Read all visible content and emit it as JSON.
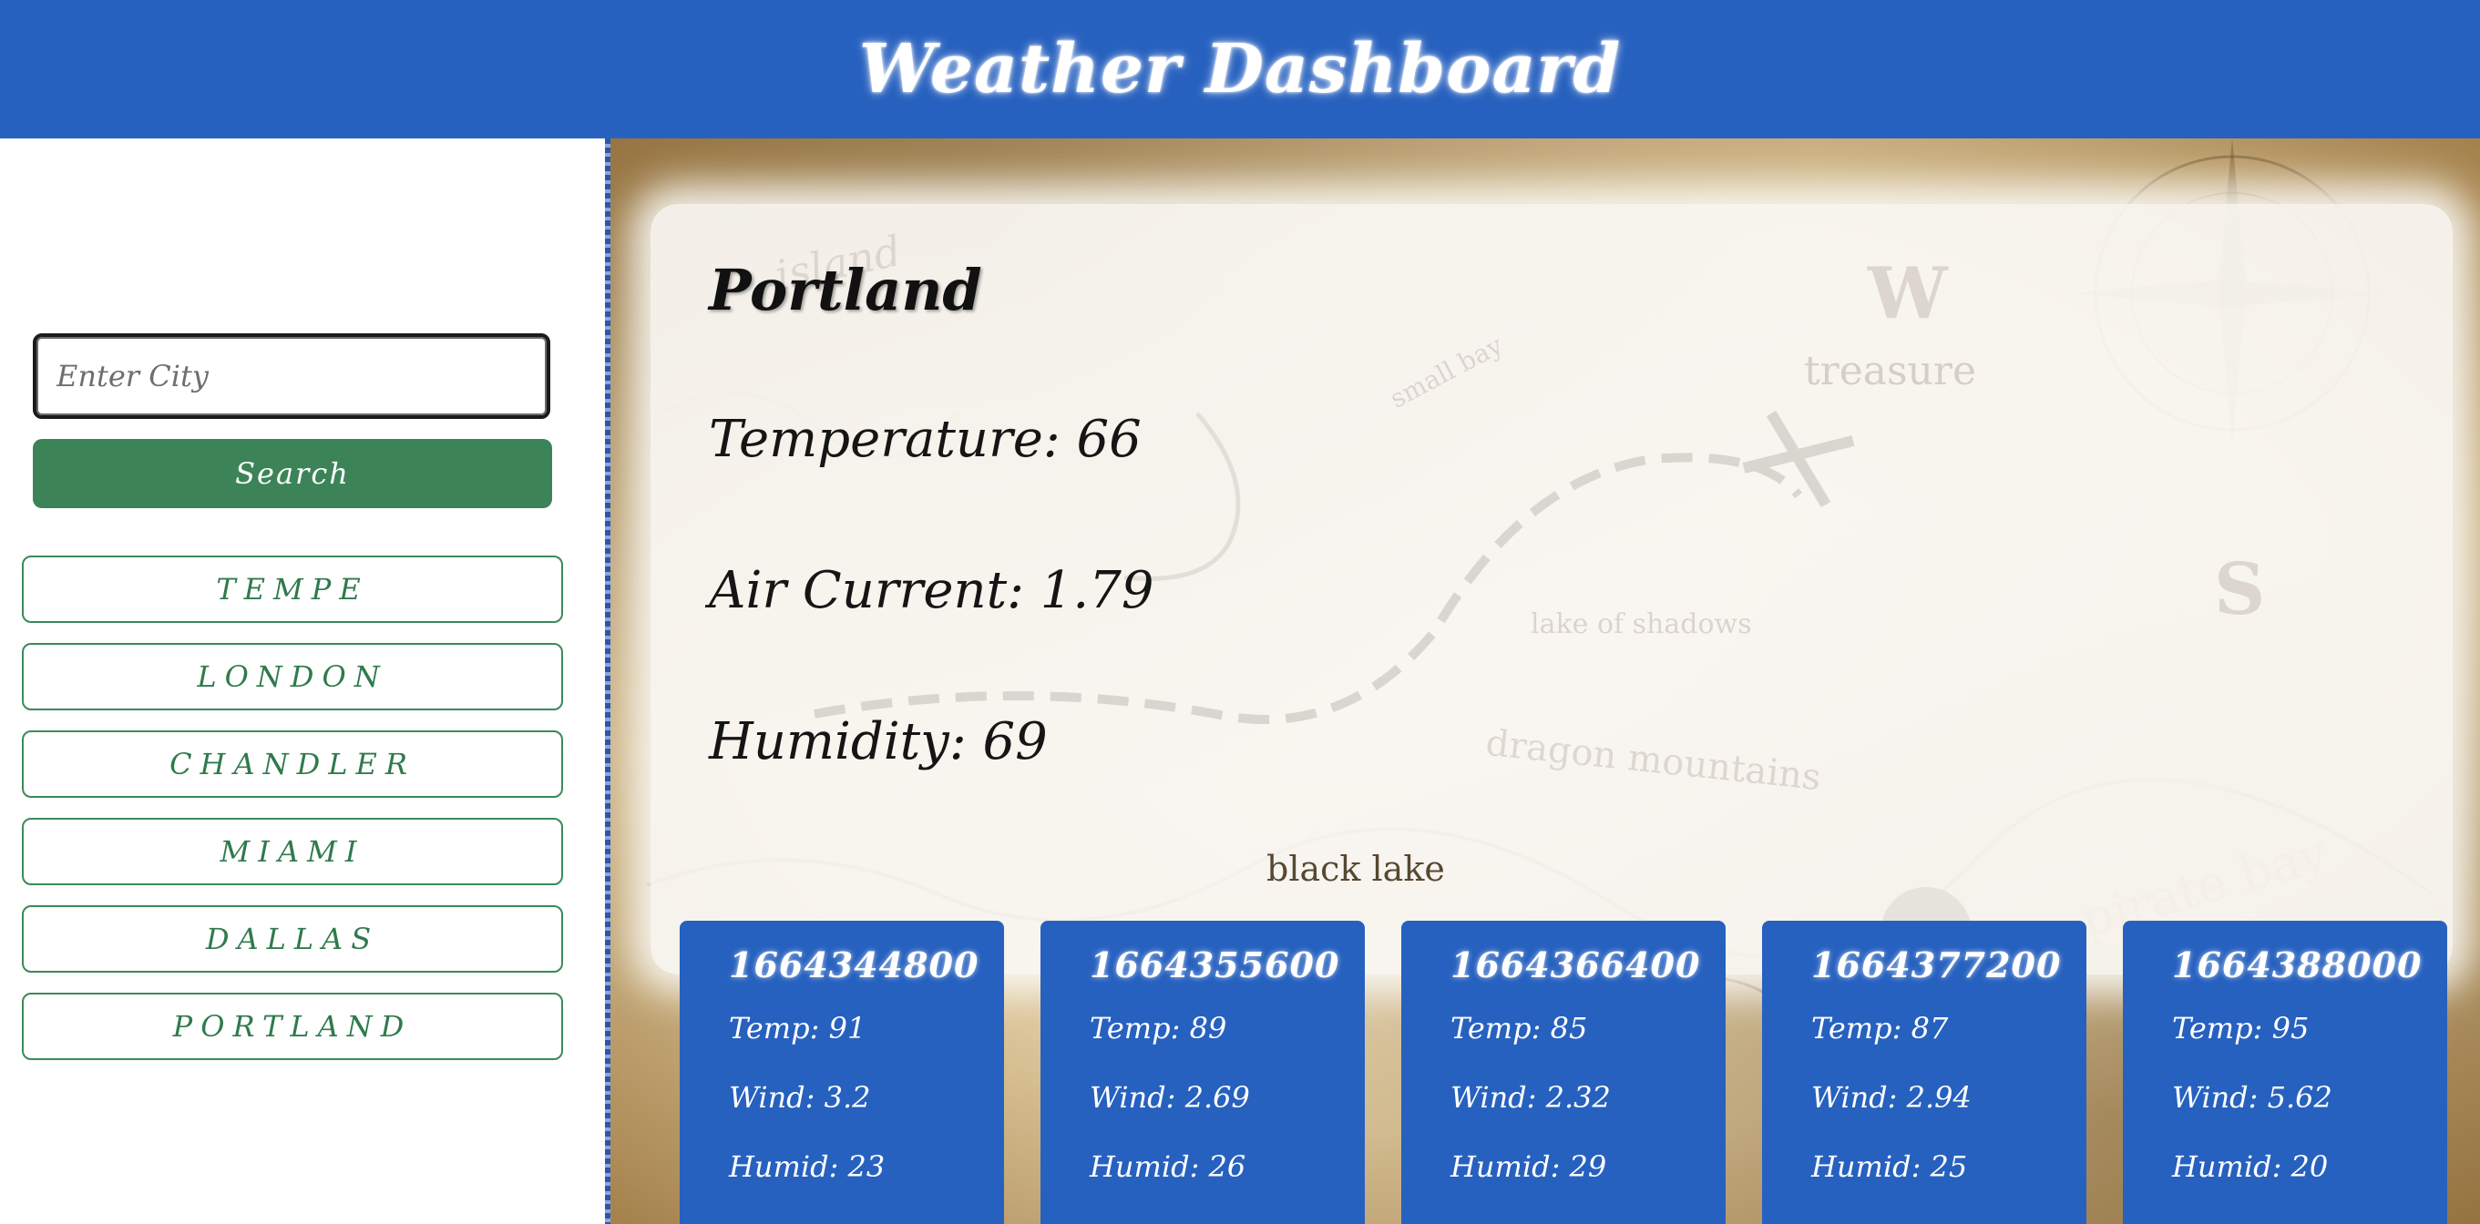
{
  "header": {
    "title": "Weather Dashboard"
  },
  "sidebar": {
    "search_placeholder": "Enter City",
    "search_button_label": "Search",
    "history": [
      "TEMPE",
      "LONDON",
      "CHANDLER",
      "MIAMI",
      "DALLAS",
      "PORTLAND"
    ]
  },
  "current": {
    "city": "Portland",
    "temperature_label": "Temperature: ",
    "temperature": "66",
    "air_current_label": "Air Current: ",
    "air_current": "1.79",
    "humidity_label": "Humidity: ",
    "humidity": "69"
  },
  "map_labels": {
    "black_lake": "black lake",
    "pirate_bay": "pirate bay",
    "treasure": "treasure",
    "dragon_mountains": "dragon mountains",
    "lake_of_shadows": "lake of shadows",
    "small_bay": "small bay",
    "island": "island",
    "w": "W",
    "s": "S",
    "stock_id": "ck | #121801600"
  },
  "forecast": {
    "temp_label": "Temp: ",
    "wind_label": "Wind: ",
    "humid_label": "Humid: ",
    "days": [
      {
        "date": "1664344800",
        "temp": "91",
        "wind": "3.2",
        "humid": "23"
      },
      {
        "date": "1664355600",
        "temp": "89",
        "wind": "2.69",
        "humid": "26"
      },
      {
        "date": "1664366400",
        "temp": "85",
        "wind": "2.32",
        "humid": "29"
      },
      {
        "date": "1664377200",
        "temp": "87",
        "wind": "2.94",
        "humid": "25"
      },
      {
        "date": "1664388000",
        "temp": "95",
        "wind": "5.62",
        "humid": "20"
      }
    ]
  },
  "colors": {
    "header_bg": "#2761bf",
    "search_button_bg": "#3c8458",
    "history_border": "#3b8a5a",
    "forecast_card_bg": "#2761bf"
  }
}
